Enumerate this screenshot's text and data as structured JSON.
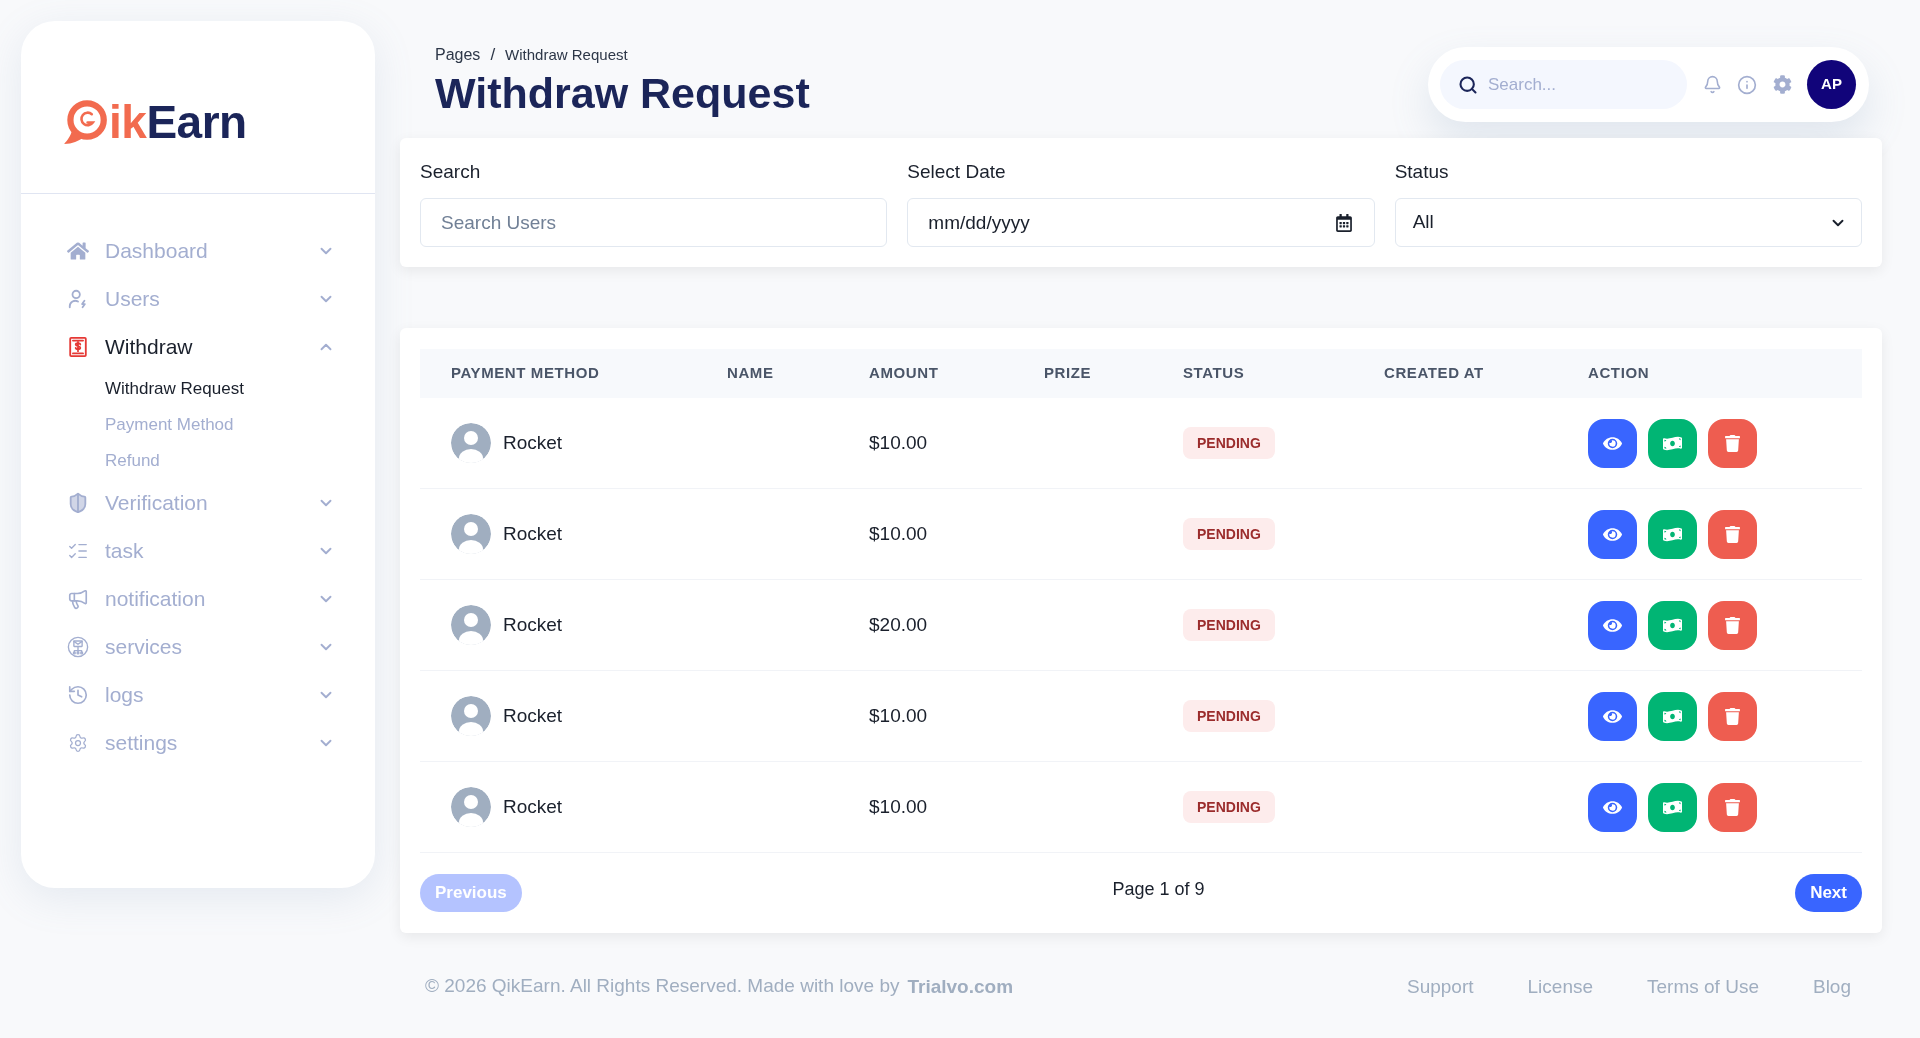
{
  "sidebar": {
    "logo": {
      "accent": "ik",
      "main": "Earn"
    },
    "nav": [
      {
        "label": "Dashboard",
        "selected": false,
        "expanded": false
      },
      {
        "label": "Users",
        "selected": false,
        "expanded": false
      },
      {
        "label": "Withdraw",
        "selected": true,
        "expanded": true,
        "children": [
          {
            "label": "Withdraw Request",
            "selected": true
          },
          {
            "label": "Payment Method",
            "selected": false
          },
          {
            "label": "Refund",
            "selected": false
          }
        ]
      },
      {
        "label": "Verification",
        "selected": false,
        "expanded": false
      },
      {
        "label": "task",
        "selected": false,
        "expanded": false
      },
      {
        "label": "notification",
        "selected": false,
        "expanded": false
      },
      {
        "label": "services",
        "selected": false,
        "expanded": false
      },
      {
        "label": "logs",
        "selected": false,
        "expanded": false
      },
      {
        "label": "settings",
        "selected": false,
        "expanded": false
      }
    ]
  },
  "breadcrumb": {
    "items": [
      "Pages",
      "Withdraw Request"
    ],
    "separator": "/"
  },
  "page_title": "Withdraw Request",
  "header": {
    "search": {
      "placeholder": "Search..."
    },
    "avatar": {
      "initials": "AP"
    }
  },
  "filters": [
    {
      "kind": "text",
      "label": "Search",
      "placeholder": "Search Users"
    },
    {
      "kind": "date",
      "label": "Select Date",
      "placeholder": "mm/dd/yyyy"
    },
    {
      "kind": "select",
      "label": "Status",
      "value": "All"
    }
  ],
  "table": {
    "columns": [
      "PAYMENT METHOD",
      "NAME",
      "AMOUNT",
      "PRIZE",
      "STATUS",
      "CREATED AT",
      "ACTION"
    ],
    "rows": [
      {
        "payment_method": "Rocket",
        "amount": "$10.00",
        "status": {
          "label": "PENDING",
          "kind": "pending"
        }
      },
      {
        "payment_method": "Rocket",
        "amount": "$10.00",
        "status": {
          "label": "PENDING",
          "kind": "pending"
        }
      },
      {
        "payment_method": "Rocket",
        "amount": "$20.00",
        "status": {
          "label": "PENDING",
          "kind": "pending"
        }
      },
      {
        "payment_method": "Rocket",
        "amount": "$10.00",
        "status": {
          "label": "PENDING",
          "kind": "pending"
        }
      },
      {
        "payment_method": "Rocket",
        "amount": "$10.00",
        "status": {
          "label": "PENDING",
          "kind": "pending"
        }
      }
    ]
  },
  "pagination": {
    "previous": {
      "label": "Previous",
      "disabled": true
    },
    "info": "Page 1 of 9",
    "next": {
      "label": "Next",
      "disabled": false
    }
  },
  "footer": {
    "copyright": "© 2026 QikEarn. All Rights Reserved. Made with love by",
    "brand_link": "Trialvo.com",
    "links": [
      "Support",
      "License",
      "Terms of Use",
      "Blog"
    ]
  }
}
